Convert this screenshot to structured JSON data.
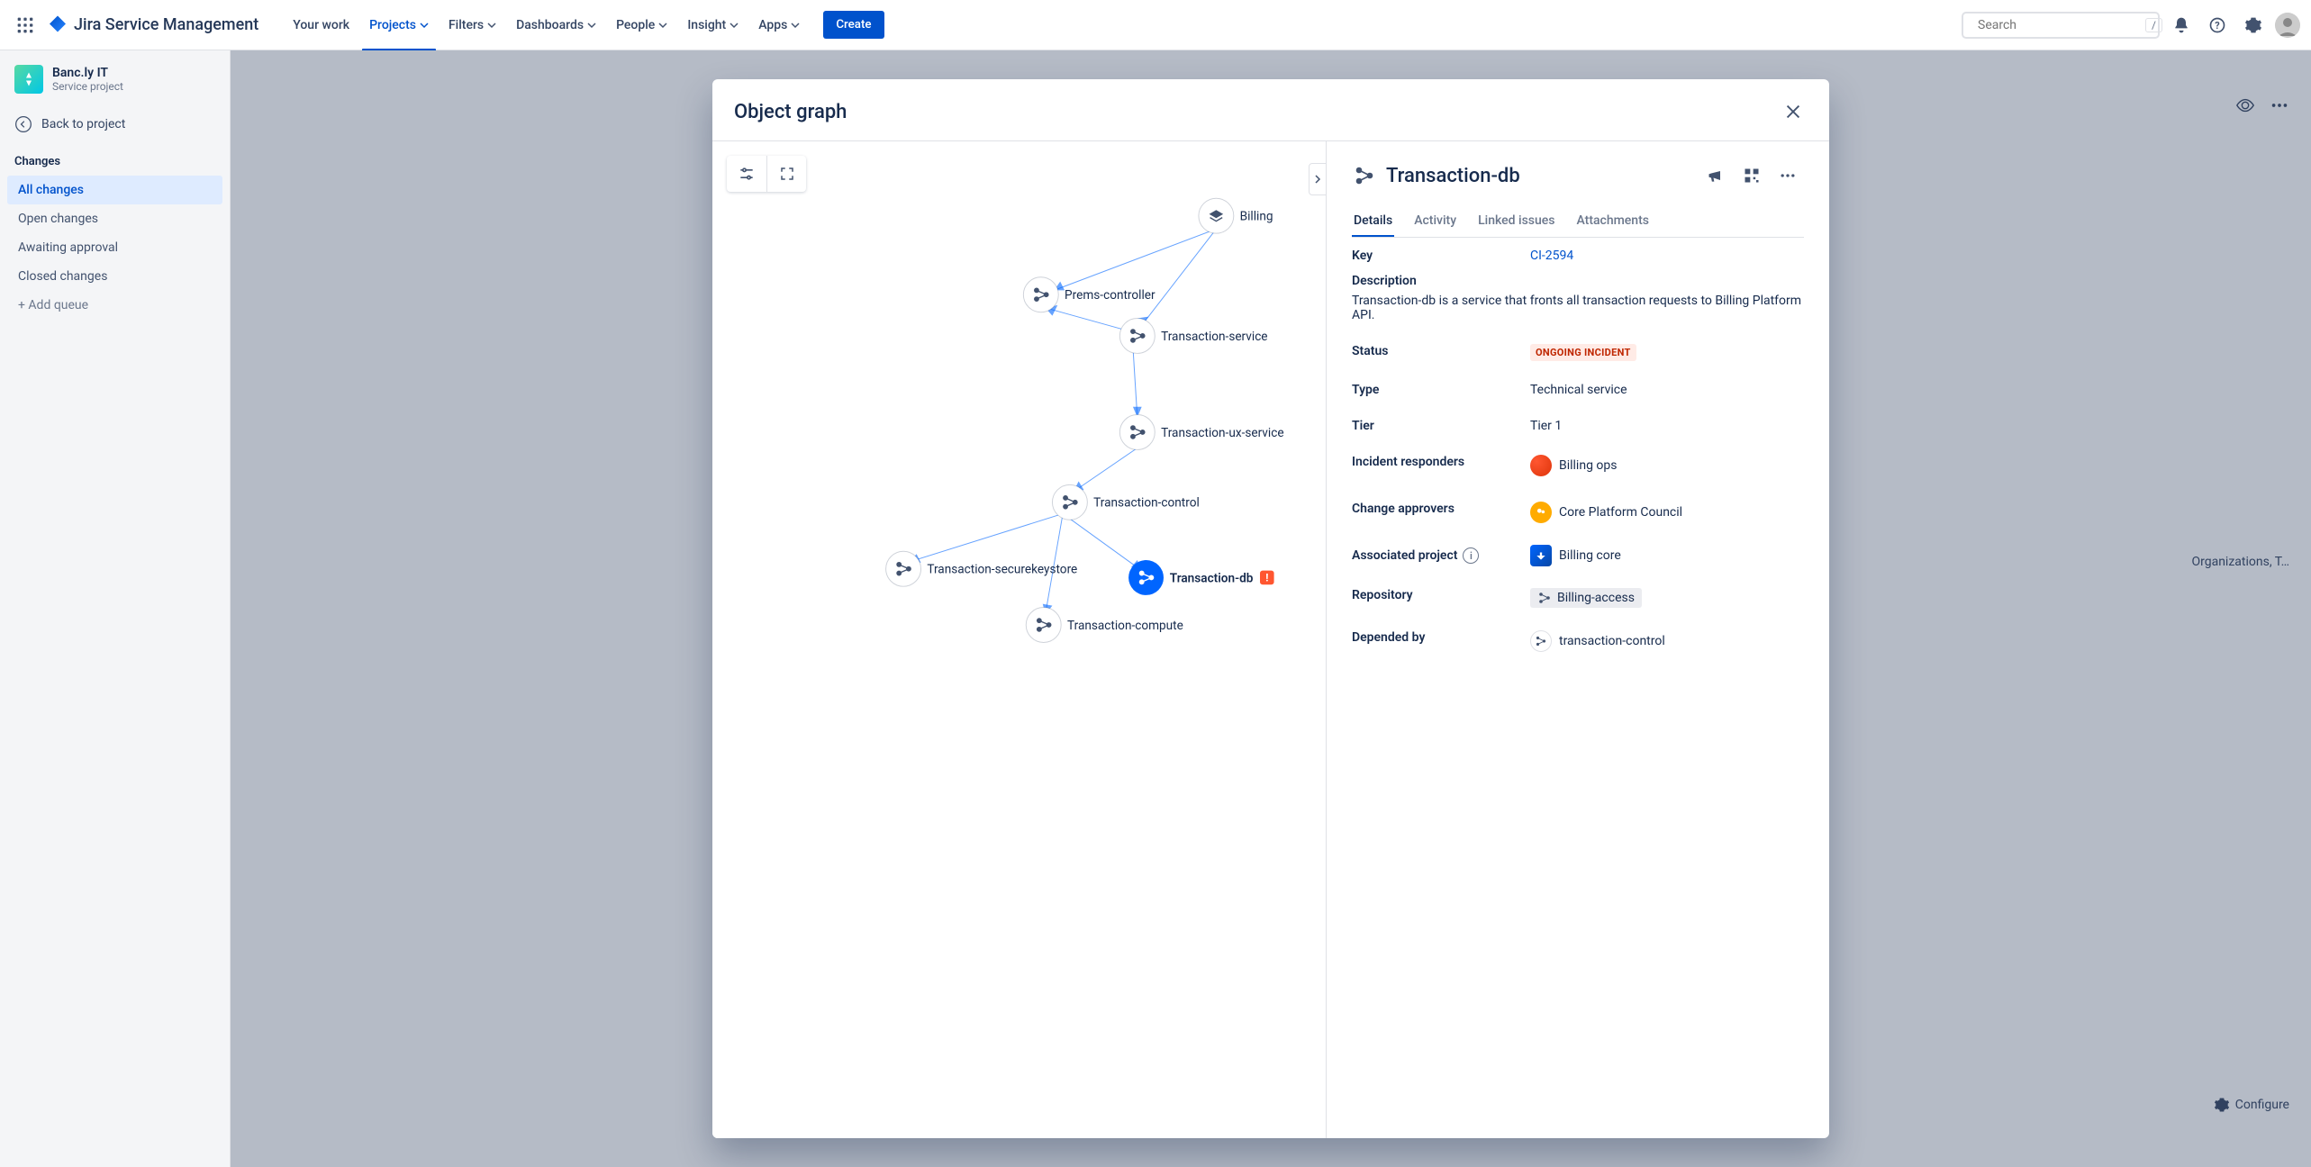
{
  "product_name": "Jira Service Management",
  "nav": {
    "your_work": "Your work",
    "projects": "Projects",
    "filters": "Filters",
    "dashboards": "Dashboards",
    "people": "People",
    "insight": "Insight",
    "apps": "Apps",
    "create": "Create"
  },
  "search": {
    "placeholder": "Search",
    "shortcut": "/"
  },
  "project": {
    "name": "Banc.ly IT",
    "type": "Service project"
  },
  "sidebar": {
    "back": "Back to project",
    "section": "Changes",
    "items": {
      "all": "All changes",
      "open": "Open changes",
      "awaiting": "Awaiting approval",
      "closed": "Closed changes"
    },
    "add_queue": "+ Add queue"
  },
  "underlying": {
    "truncated_right": "Organizations, T…",
    "configure": "Configure"
  },
  "modal": {
    "title": "Object graph",
    "selected_object": "Transaction-db",
    "tabs": {
      "details": "Details",
      "activity": "Activity",
      "linked": "Linked issues",
      "attachments": "Attachments"
    },
    "fields": {
      "key_label": "Key",
      "key_value": "CI-2594",
      "description_label": "Description",
      "description_value": "Transaction-db is a service that fronts all transaction requests to Billing Platform API.",
      "status_label": "Status",
      "status_value": "ONGOING INCIDENT",
      "type_label": "Type",
      "type_value": "Technical service",
      "tier_label": "Tier",
      "tier_value": "Tier 1",
      "responders_label": "Incident responders",
      "responders_value": "Billing ops",
      "approvers_label": "Change approvers",
      "approvers_value": "Core Platform Council",
      "assoc_label": "Associated project",
      "assoc_value": "Billing core",
      "repo_label": "Repository",
      "repo_value": "Billing-access",
      "depended_label": "Depended by",
      "depended_value": "transaction-control"
    },
    "graph_nodes": {
      "billing": "Billing",
      "prems": "Prems-controller",
      "txn_service": "Transaction-service",
      "txn_ux": "Transaction-ux-service",
      "txn_control": "Transaction-control",
      "txn_secure": "Transaction-securekeystore",
      "txn_db": "Transaction-db",
      "txn_compute": "Transaction-compute"
    }
  }
}
